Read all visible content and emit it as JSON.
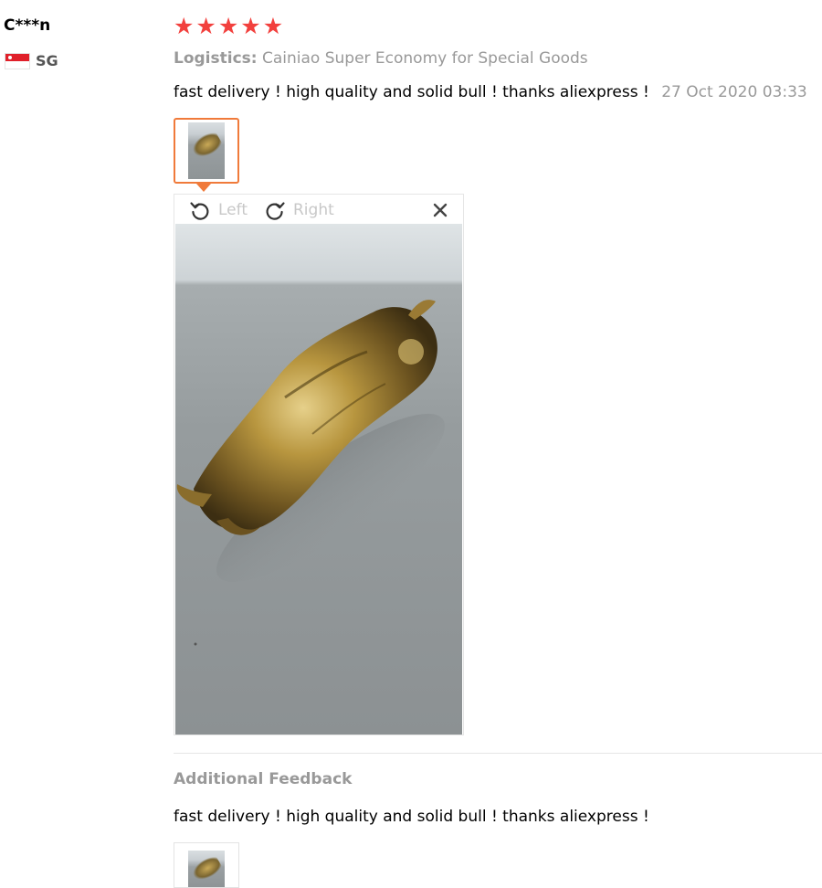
{
  "reviewer": {
    "name": "C***n",
    "country_code": "SG",
    "flag_icon": "singapore-flag-icon"
  },
  "rating": {
    "stars": 5,
    "star_color": "#f2403d"
  },
  "logistics": {
    "label": "Logistics:",
    "value": "Cainiao Super Economy for Special Goods"
  },
  "review": {
    "text": "fast delivery ! high quality and solid bull ! thanks aliexpress !",
    "date": "27 Oct 2020 03:33"
  },
  "viewer": {
    "rotate_left_label": "Left",
    "rotate_right_label": "Right",
    "rotate_left_icon": "rotate-left-icon",
    "rotate_right_icon": "rotate-right-icon",
    "close_icon": "close-icon",
    "accent_color": "#f07a3a"
  },
  "additional_feedback": {
    "title": "Additional Feedback",
    "text": "fast delivery ! high quality and solid bull ! thanks aliexpress !"
  }
}
